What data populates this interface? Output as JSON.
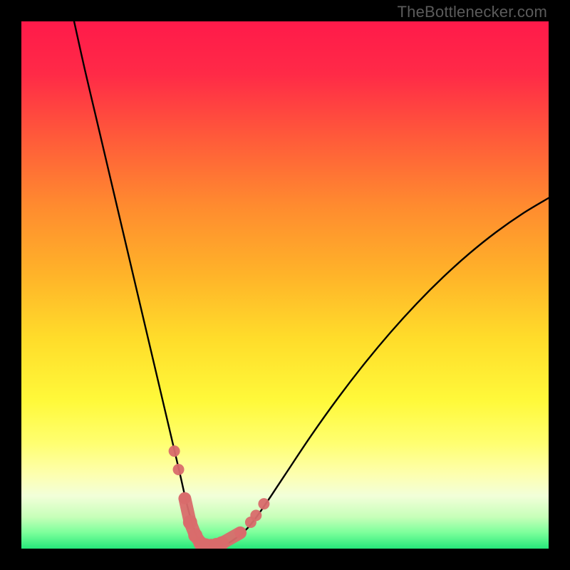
{
  "watermark": "TheBottlenecker.com",
  "gradient": {
    "stops": [
      {
        "offset": 0.0,
        "color": "#ff1a4a"
      },
      {
        "offset": 0.1,
        "color": "#ff2a47"
      },
      {
        "offset": 0.22,
        "color": "#ff5a3a"
      },
      {
        "offset": 0.35,
        "color": "#ff8b2f"
      },
      {
        "offset": 0.48,
        "color": "#ffb329"
      },
      {
        "offset": 0.6,
        "color": "#ffdc2a"
      },
      {
        "offset": 0.72,
        "color": "#fff93a"
      },
      {
        "offset": 0.8,
        "color": "#ffff70"
      },
      {
        "offset": 0.86,
        "color": "#fdffb0"
      },
      {
        "offset": 0.9,
        "color": "#f2ffd9"
      },
      {
        "offset": 0.94,
        "color": "#c7ffb9"
      },
      {
        "offset": 0.97,
        "color": "#7bff9b"
      },
      {
        "offset": 1.0,
        "color": "#26e87a"
      }
    ]
  },
  "chart_data": {
    "type": "line",
    "title": "",
    "xlabel": "",
    "ylabel": "",
    "xlim": [
      0,
      100
    ],
    "ylim": [
      0,
      100
    ],
    "series": [
      {
        "name": "bottleneck-curve",
        "color": "#000000",
        "x": [
          10.0,
          12.0,
          14.0,
          16.0,
          18.0,
          20.0,
          22.0,
          24.0,
          26.0,
          28.0,
          30.0,
          31.5,
          33.0,
          34.5,
          36.0,
          38.0,
          40.0,
          43.0,
          46.0,
          50.0,
          55.0,
          60.0,
          65.0,
          70.0,
          75.0,
          80.0,
          85.0,
          90.0,
          95.0,
          100.0
        ],
        "y": [
          100.0,
          91.0,
          82.5,
          74.0,
          65.5,
          57.0,
          48.5,
          40.0,
          31.5,
          23.0,
          14.5,
          8.0,
          3.0,
          0.8,
          0.4,
          0.6,
          1.5,
          4.0,
          8.0,
          14.0,
          21.5,
          28.5,
          35.0,
          41.0,
          46.5,
          51.5,
          56.0,
          60.0,
          63.5,
          66.5
        ]
      }
    ],
    "markers": {
      "name": "highlight-nodes",
      "color": "#d96b6b",
      "points": [
        {
          "x": 29.0,
          "y": 18.5
        },
        {
          "x": 29.8,
          "y": 15.0
        },
        {
          "x": 31.0,
          "y": 9.5
        },
        {
          "x": 32.0,
          "y": 5.0
        },
        {
          "x": 33.0,
          "y": 2.5
        },
        {
          "x": 34.0,
          "y": 1.0
        },
        {
          "x": 35.0,
          "y": 0.6
        },
        {
          "x": 36.0,
          "y": 0.5
        },
        {
          "x": 37.0,
          "y": 0.7
        },
        {
          "x": 38.0,
          "y": 1.0
        },
        {
          "x": 41.5,
          "y": 3.0
        },
        {
          "x": 43.5,
          "y": 5.0
        },
        {
          "x": 44.5,
          "y": 6.3
        },
        {
          "x": 46.0,
          "y": 8.5
        }
      ]
    }
  }
}
